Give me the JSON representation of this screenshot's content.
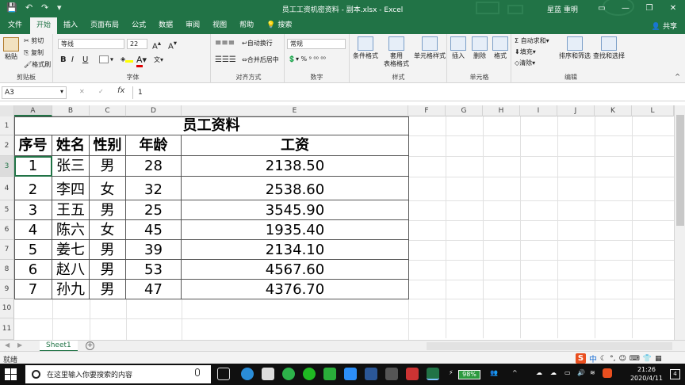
{
  "window": {
    "title": "员工工资机密资料 - 副本.xlsx  -  Excel",
    "user": "星蓝 重明",
    "controls": [
      "—",
      "❐",
      "✕"
    ]
  },
  "tabs": [
    "文件",
    "开始",
    "插入",
    "页面布局",
    "公式",
    "数据",
    "审阅",
    "视图",
    "帮助",
    "搜索"
  ],
  "share_label": "共享",
  "ribbon": {
    "clipboard": {
      "cut": "剪切",
      "copy": "复制",
      "paste": "粘贴",
      "format_painter": "格式刷",
      "label": "剪贴板"
    },
    "font": {
      "name": "等线",
      "size": "22",
      "bold": "B",
      "italic": "I",
      "underline": "U",
      "label": "字体",
      "font_color_glyph": "A"
    },
    "alignment": {
      "wrap": "自动换行",
      "merge": "合并后居中",
      "label": "对齐方式"
    },
    "number": {
      "format": "常规",
      "label": "数字"
    },
    "styles": {
      "conditional": "条件格式",
      "table_line1": "套用",
      "table_line2": "表格格式",
      "cell_styles": "单元格样式",
      "label": "样式"
    },
    "cells": {
      "insert": "插入",
      "delete": "删除",
      "format": "格式",
      "label": "单元格"
    },
    "editing": {
      "autosum": "自动求和",
      "fill": "填充",
      "clear": "清除",
      "sort": "排序和筛选",
      "find": "查找和选择",
      "label": "编辑"
    }
  },
  "formula_bar": {
    "name_box": "A3",
    "fx": "fx",
    "value": "1"
  },
  "columns": [
    "A",
    "B",
    "C",
    "D",
    "E",
    "F",
    "G",
    "H",
    "I",
    "J",
    "K",
    "L"
  ],
  "rows": [
    "1",
    "2",
    "3",
    "4",
    "5",
    "6",
    "7",
    "8",
    "9",
    "10",
    "11"
  ],
  "sheet": {
    "title": "员工资料",
    "headers": [
      "序号",
      "姓名",
      "性别",
      "年龄",
      "工资"
    ],
    "records": [
      [
        "1",
        "张三",
        "男",
        "28",
        "2138.50"
      ],
      [
        "2",
        "李四",
        "女",
        "32",
        "2538.60"
      ],
      [
        "3",
        "王五",
        "男",
        "25",
        "3545.90"
      ],
      [
        "4",
        "陈六",
        "女",
        "45",
        "1935.40"
      ],
      [
        "5",
        "姜七",
        "男",
        "39",
        "2134.10"
      ],
      [
        "6",
        "赵八",
        "男",
        "53",
        "4567.60"
      ],
      [
        "7",
        "孙九",
        "男",
        "47",
        "4376.70"
      ]
    ]
  },
  "sheet_tabs": [
    "Sheet1"
  ],
  "status": {
    "ready": "就绪",
    "ime_mode": "中"
  },
  "taskbar": {
    "search_placeholder": "在这里输入你要搜索的内容",
    "battery": "98%",
    "time": "21:26",
    "date": "2020/4/11",
    "notification_count": "4"
  },
  "colors": {
    "excel_green": "#217346",
    "ime_orange": "#e94f1f"
  }
}
